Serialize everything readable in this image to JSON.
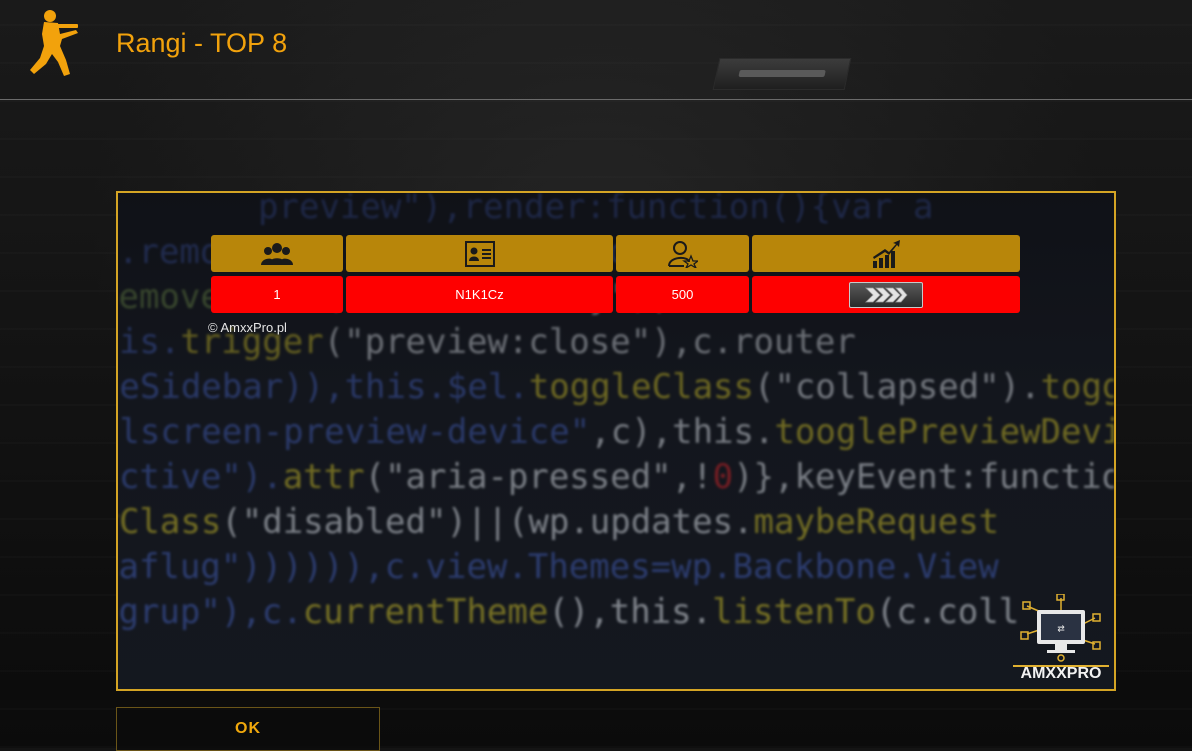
{
  "header": {
    "title": "Rangi - TOP 8"
  },
  "table": {
    "columns": [
      {
        "icon": "players-icon"
      },
      {
        "icon": "id-card-icon"
      },
      {
        "icon": "user-star-icon"
      },
      {
        "icon": "rank-chart-icon"
      }
    ],
    "rows": [
      {
        "position": "1",
        "name": "N1K1Cz",
        "points": "500",
        "rank_icon": "rank-chevrons-icon"
      }
    ]
  },
  "footer": {
    "copyright": "© AmxxPro.pl",
    "ok_label": "OK"
  },
  "brand": {
    "logo_text": "AMXXPRO"
  },
  "colors": {
    "accent": "#f2a20c",
    "header_cell": "#b8860a",
    "data_cell": "#fe0000",
    "panel_border": "#d4a424"
  }
}
